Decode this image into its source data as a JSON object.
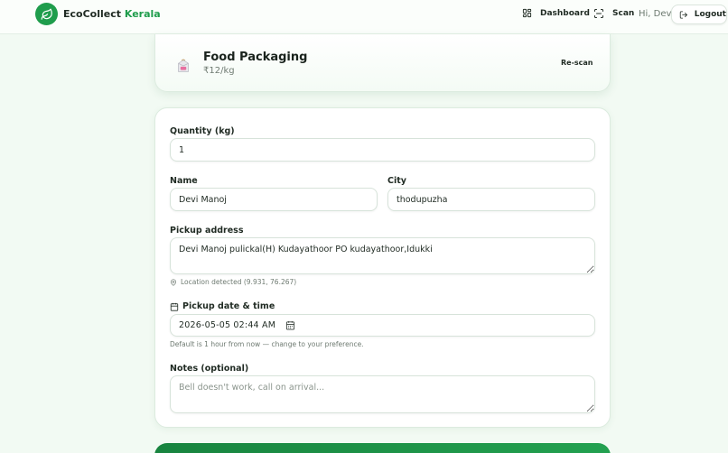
{
  "header": {
    "brand_main": "EcoCollect",
    "brand_accent": "Kerala",
    "nav": {
      "dashboard_label": "Dashboard",
      "scan_label": "Scan"
    },
    "greeting": "Hi, Devi",
    "logout_label": "Logout"
  },
  "product": {
    "name": "Food Packaging",
    "price": "₹12/kg",
    "rescan_label": "Re-scan"
  },
  "form": {
    "quantity": {
      "label": "Quantity (kg)",
      "value": "1"
    },
    "name": {
      "label": "Name",
      "value": "Devi Manoj"
    },
    "city": {
      "label": "City",
      "value": "thodupuzha"
    },
    "address": {
      "label": "Pickup address",
      "value": "Devi Manoj pulickal(H) Kudayathoor PO kudayathoor,Idukki",
      "location_hint": "Location detected (9.931, 76.267)"
    },
    "pickup": {
      "label": "Pickup date & time",
      "value": "2026-05-05 02:44 AM",
      "hint": "Default is 1 hour from now — change to your preference."
    },
    "notes": {
      "label": "Notes (optional)",
      "placeholder": "Bell doesn't work, call on arrival..."
    }
  },
  "colors": {
    "accent": "#1f9d4c",
    "background": "#f2faf3"
  }
}
